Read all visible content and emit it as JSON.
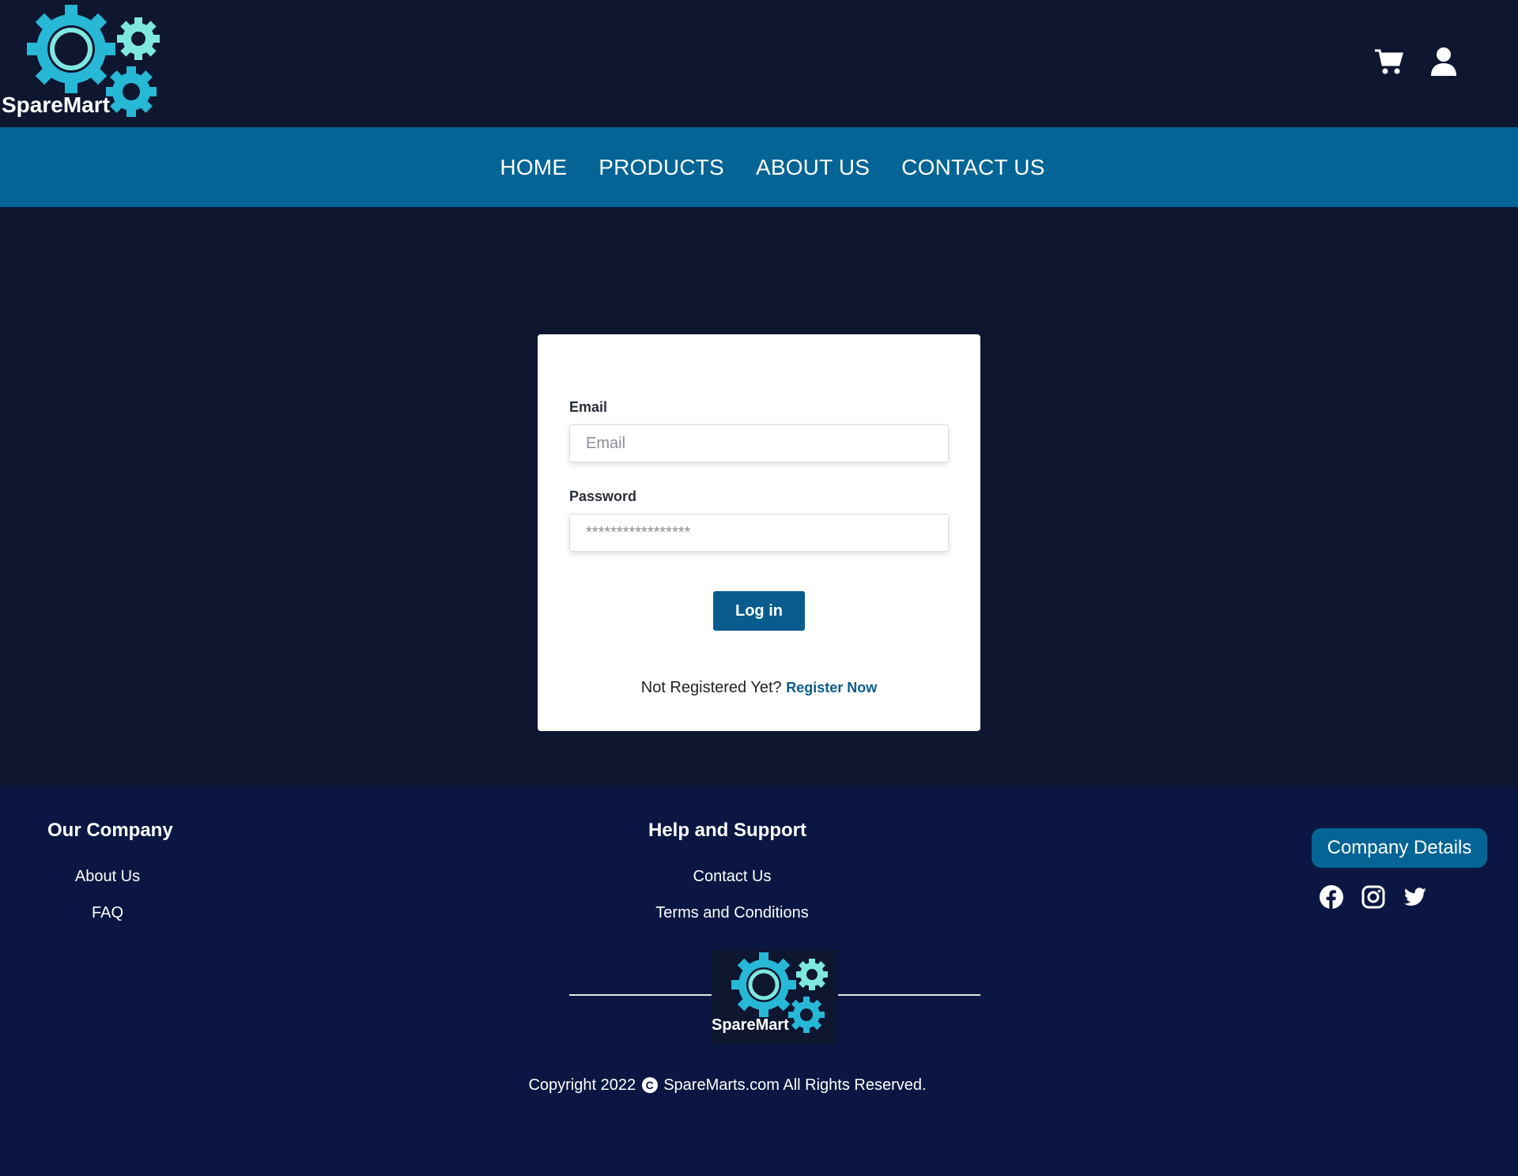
{
  "brand": {
    "name": "SpareMart",
    "logo_colors": [
      "#27b8d6",
      "#7ee8e0",
      "#ffffff"
    ]
  },
  "header": {
    "cart_icon": "cart-icon",
    "user_icon": "user-icon"
  },
  "nav": {
    "items": [
      {
        "label": "HOME"
      },
      {
        "label": "PRODUCTS"
      },
      {
        "label": "ABOUT US"
      },
      {
        "label": "CONTACT US"
      }
    ]
  },
  "login": {
    "email_label": "Email",
    "email_placeholder": "Email",
    "email_value": "",
    "password_label": "Password",
    "password_placeholder": "*****************",
    "password_value": "",
    "submit_label": "Log in",
    "register_prompt": "Not Registered Yet?",
    "register_link": "Register Now"
  },
  "footer": {
    "our_company": {
      "title": "Our Company",
      "links": [
        "About Us",
        "FAQ"
      ]
    },
    "help_support": {
      "title": "Help and Support",
      "links": [
        "Contact Us",
        "Terms and Conditions"
      ]
    },
    "company_details_label": "Company Details",
    "social_icons": [
      "facebook-icon",
      "instagram-icon",
      "twitter-icon"
    ],
    "copyright_prefix": "Copyright 2022",
    "copyright_suffix": "SpareMarts.com All Rights Reserved."
  },
  "colors": {
    "page_bg": "#0e1630",
    "nav_bg": "#046495",
    "footer_bg": "#0b1742",
    "button_bg": "#0a5c8f",
    "link": "#0a5c8f"
  }
}
